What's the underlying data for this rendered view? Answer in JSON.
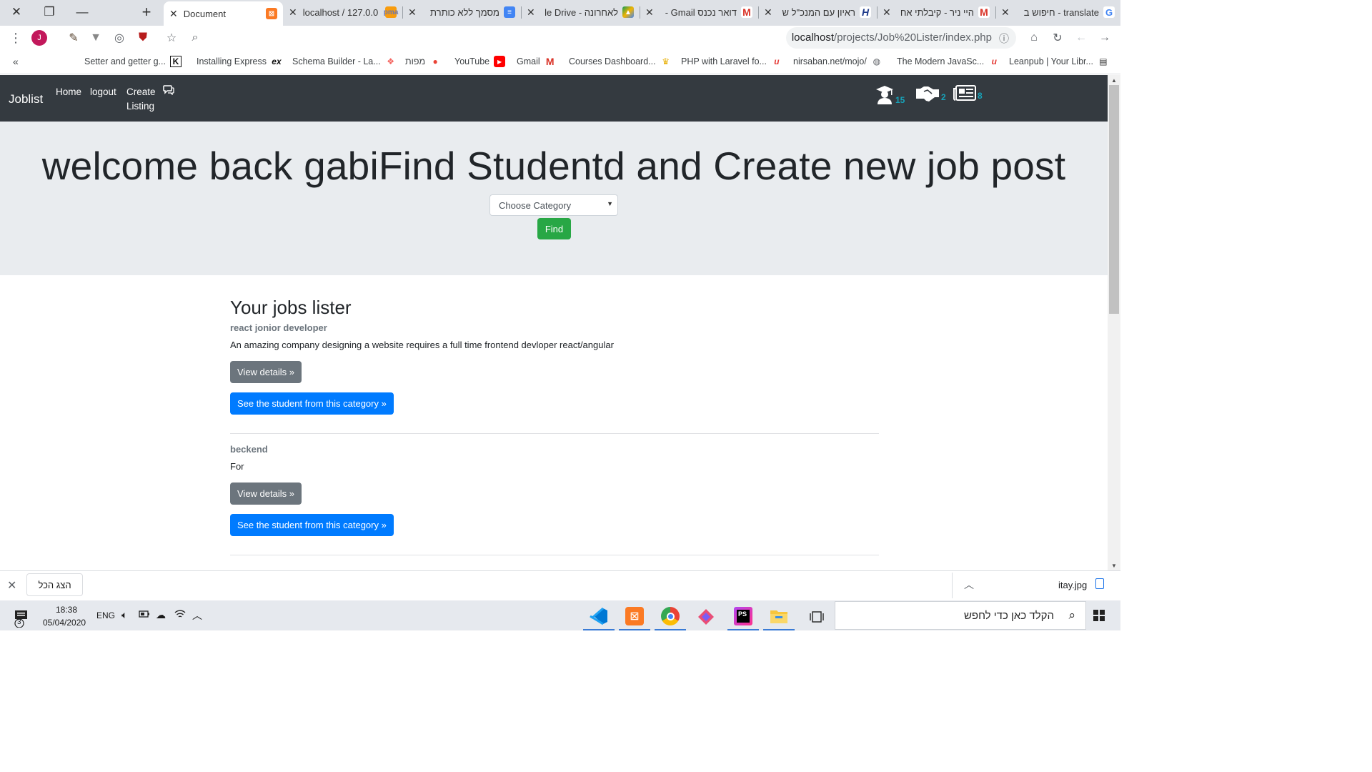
{
  "tabs": [
    {
      "title": "Document",
      "active": true
    },
    {
      "title": "localhost / 127.0.0"
    },
    {
      "title": "מסמך ללא כותרת"
    },
    {
      "title": "le Drive - לאחרונה"
    },
    {
      "title": "- Gmail דואר נכנס"
    },
    {
      "title": "ראיון עם המנכ\"ל ש"
    },
    {
      "title": "היי ניר - קיבלתי אח"
    },
    {
      "title": "חיפוש ב - translate"
    }
  ],
  "toolbar": {
    "url_host": "localhost",
    "url_path": "/projects/Job%20Lister/index.php",
    "profile_initial": "J"
  },
  "bookmarks": [
    {
      "label": "Setter and getter g..."
    },
    {
      "label": "Installing Express"
    },
    {
      "label": "Schema Builder - La..."
    },
    {
      "label": "מפות"
    },
    {
      "label": "YouTube"
    },
    {
      "label": "Gmail"
    },
    {
      "label": "Courses Dashboard..."
    },
    {
      "label": "PHP with Laravel fo..."
    },
    {
      "label": "nirsaban.net/mojo/"
    },
    {
      "label": "The Modern JavaSc..."
    },
    {
      "label": "Leanpub | Your Libr..."
    }
  ],
  "navbar": {
    "brand": "Joblist",
    "links": [
      "Home",
      "logout",
      "Create",
      "Listing"
    ],
    "counts": {
      "students": "15",
      "deals": "2",
      "listings": "8"
    }
  },
  "hero": {
    "headline": "welcome back gabiFind Studentd and Create new job post",
    "select_value": "Choose Category",
    "find_label": "Find"
  },
  "main": {
    "heading": "Your jobs lister",
    "view_label": "View details »",
    "see_label": "See the student from this category »",
    "jobs": [
      {
        "title": "react jonior developer",
        "description": "An amazing company designing a website requires a full time frontend devloper react/angular"
      },
      {
        "title": "beckend",
        "description": "For"
      }
    ]
  },
  "download_bar": {
    "show_all": "הצג הכל",
    "file_name": "itay.jpg"
  },
  "taskbar": {
    "time": "18:38",
    "date": "05/04/2020",
    "lang": "ENG",
    "notif_count": "3",
    "search_placeholder": "הקלד כאן כדי לחפש"
  },
  "colors": {
    "navbar_bg": "#343a40",
    "jumbotron_bg": "#e9ecef",
    "find_green": "#28a745",
    "primary_blue": "#007bff",
    "secondary_gray": "#6c757d",
    "count_teal": "#17a2b8"
  }
}
